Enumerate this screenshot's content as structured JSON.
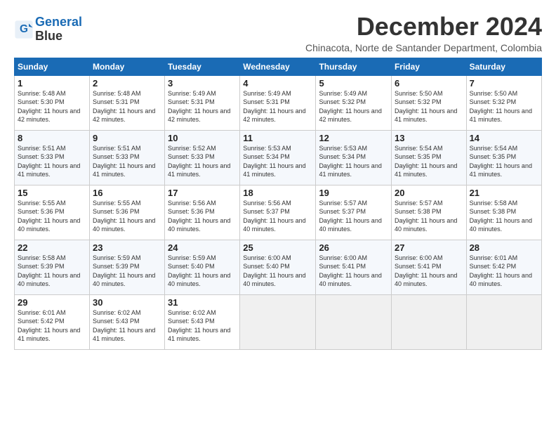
{
  "logo": {
    "line1": "General",
    "line2": "Blue"
  },
  "title": "December 2024",
  "location": "Chinacota, Norte de Santander Department, Colombia",
  "days_header": [
    "Sunday",
    "Monday",
    "Tuesday",
    "Wednesday",
    "Thursday",
    "Friday",
    "Saturday"
  ],
  "weeks": [
    [
      {
        "day": "1",
        "sunrise": "5:48 AM",
        "sunset": "5:30 PM",
        "daylight": "11 hours and 42 minutes."
      },
      {
        "day": "2",
        "sunrise": "5:48 AM",
        "sunset": "5:31 PM",
        "daylight": "11 hours and 42 minutes."
      },
      {
        "day": "3",
        "sunrise": "5:49 AM",
        "sunset": "5:31 PM",
        "daylight": "11 hours and 42 minutes."
      },
      {
        "day": "4",
        "sunrise": "5:49 AM",
        "sunset": "5:31 PM",
        "daylight": "11 hours and 42 minutes."
      },
      {
        "day": "5",
        "sunrise": "5:49 AM",
        "sunset": "5:32 PM",
        "daylight": "11 hours and 42 minutes."
      },
      {
        "day": "6",
        "sunrise": "5:50 AM",
        "sunset": "5:32 PM",
        "daylight": "11 hours and 41 minutes."
      },
      {
        "day": "7",
        "sunrise": "5:50 AM",
        "sunset": "5:32 PM",
        "daylight": "11 hours and 41 minutes."
      }
    ],
    [
      {
        "day": "8",
        "sunrise": "5:51 AM",
        "sunset": "5:33 PM",
        "daylight": "11 hours and 41 minutes."
      },
      {
        "day": "9",
        "sunrise": "5:51 AM",
        "sunset": "5:33 PM",
        "daylight": "11 hours and 41 minutes."
      },
      {
        "day": "10",
        "sunrise": "5:52 AM",
        "sunset": "5:33 PM",
        "daylight": "11 hours and 41 minutes."
      },
      {
        "day": "11",
        "sunrise": "5:53 AM",
        "sunset": "5:34 PM",
        "daylight": "11 hours and 41 minutes."
      },
      {
        "day": "12",
        "sunrise": "5:53 AM",
        "sunset": "5:34 PM",
        "daylight": "11 hours and 41 minutes."
      },
      {
        "day": "13",
        "sunrise": "5:54 AM",
        "sunset": "5:35 PM",
        "daylight": "11 hours and 41 minutes."
      },
      {
        "day": "14",
        "sunrise": "5:54 AM",
        "sunset": "5:35 PM",
        "daylight": "11 hours and 41 minutes."
      }
    ],
    [
      {
        "day": "15",
        "sunrise": "5:55 AM",
        "sunset": "5:36 PM",
        "daylight": "11 hours and 40 minutes."
      },
      {
        "day": "16",
        "sunrise": "5:55 AM",
        "sunset": "5:36 PM",
        "daylight": "11 hours and 40 minutes."
      },
      {
        "day": "17",
        "sunrise": "5:56 AM",
        "sunset": "5:36 PM",
        "daylight": "11 hours and 40 minutes."
      },
      {
        "day": "18",
        "sunrise": "5:56 AM",
        "sunset": "5:37 PM",
        "daylight": "11 hours and 40 minutes."
      },
      {
        "day": "19",
        "sunrise": "5:57 AM",
        "sunset": "5:37 PM",
        "daylight": "11 hours and 40 minutes."
      },
      {
        "day": "20",
        "sunrise": "5:57 AM",
        "sunset": "5:38 PM",
        "daylight": "11 hours and 40 minutes."
      },
      {
        "day": "21",
        "sunrise": "5:58 AM",
        "sunset": "5:38 PM",
        "daylight": "11 hours and 40 minutes."
      }
    ],
    [
      {
        "day": "22",
        "sunrise": "5:58 AM",
        "sunset": "5:39 PM",
        "daylight": "11 hours and 40 minutes."
      },
      {
        "day": "23",
        "sunrise": "5:59 AM",
        "sunset": "5:39 PM",
        "daylight": "11 hours and 40 minutes."
      },
      {
        "day": "24",
        "sunrise": "5:59 AM",
        "sunset": "5:40 PM",
        "daylight": "11 hours and 40 minutes."
      },
      {
        "day": "25",
        "sunrise": "6:00 AM",
        "sunset": "5:40 PM",
        "daylight": "11 hours and 40 minutes."
      },
      {
        "day": "26",
        "sunrise": "6:00 AM",
        "sunset": "5:41 PM",
        "daylight": "11 hours and 40 minutes."
      },
      {
        "day": "27",
        "sunrise": "6:00 AM",
        "sunset": "5:41 PM",
        "daylight": "11 hours and 40 minutes."
      },
      {
        "day": "28",
        "sunrise": "6:01 AM",
        "sunset": "5:42 PM",
        "daylight": "11 hours and 40 minutes."
      }
    ],
    [
      {
        "day": "29",
        "sunrise": "6:01 AM",
        "sunset": "5:42 PM",
        "daylight": "11 hours and 41 minutes."
      },
      {
        "day": "30",
        "sunrise": "6:02 AM",
        "sunset": "5:43 PM",
        "daylight": "11 hours and 41 minutes."
      },
      {
        "day": "31",
        "sunrise": "6:02 AM",
        "sunset": "5:43 PM",
        "daylight": "11 hours and 41 minutes."
      },
      null,
      null,
      null,
      null
    ]
  ]
}
